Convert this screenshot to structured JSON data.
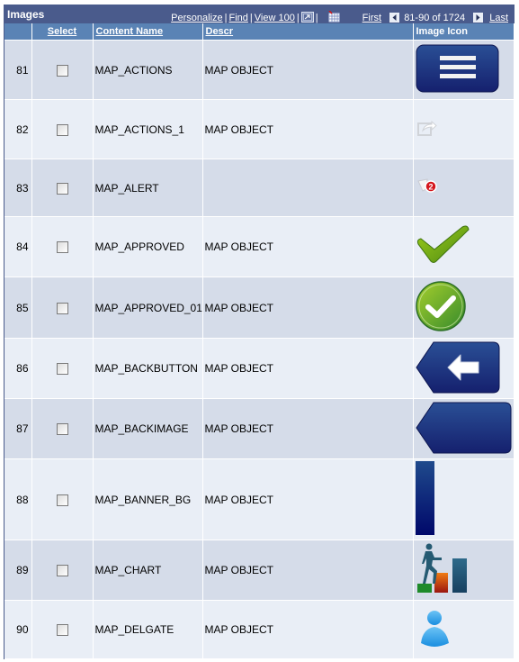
{
  "grid": {
    "title": "Images",
    "nav": {
      "personalize": "Personalize",
      "find": "Find",
      "view_all": "View 100",
      "separator": "|",
      "first": "First",
      "range": "81-90 of 1724",
      "last": "Last"
    },
    "columns": {
      "row_num": "",
      "select": "Select",
      "content_name": "Content Name",
      "descr": "Descr",
      "image_icon": "Image Icon"
    },
    "rows": [
      {
        "num": "81",
        "selected": false,
        "content_name": "MAP_ACTIONS",
        "descr": "MAP OBJECT",
        "icon": "menu-button-icon"
      },
      {
        "num": "82",
        "selected": false,
        "content_name": "MAP_ACTIONS_1",
        "descr": "MAP OBJECT",
        "icon": "share-icon"
      },
      {
        "num": "83",
        "selected": false,
        "content_name": "MAP_ALERT",
        "descr": "",
        "icon": "alert-flag-icon",
        "badge": "2"
      },
      {
        "num": "84",
        "selected": false,
        "content_name": "MAP_APPROVED",
        "descr": "MAP OBJECT",
        "icon": "checkmark-icon"
      },
      {
        "num": "85",
        "selected": false,
        "content_name": "MAP_APPROVED_01",
        "descr": "MAP OBJECT",
        "icon": "check-circle-icon"
      },
      {
        "num": "86",
        "selected": false,
        "content_name": "MAP_BACKBUTTON",
        "descr": "MAP OBJECT",
        "icon": "back-button-icon"
      },
      {
        "num": "87",
        "selected": false,
        "content_name": "MAP_BACKIMAGE",
        "descr": "MAP OBJECT",
        "icon": "back-image-icon"
      },
      {
        "num": "88",
        "selected": false,
        "content_name": "MAP_BANNER_BG",
        "descr": "MAP OBJECT",
        "icon": "banner-bg-icon"
      },
      {
        "num": "89",
        "selected": false,
        "content_name": "MAP_CHART",
        "descr": "MAP OBJECT",
        "icon": "chart-icon"
      },
      {
        "num": "90",
        "selected": false,
        "content_name": "MAP_DELGATE",
        "descr": "MAP OBJECT",
        "icon": "user-icon"
      }
    ],
    "colors": {
      "title_bar": "#4a5b8c",
      "header": "#5a83b5",
      "row_odd": "#d5dce9",
      "row_even": "#e9eef6",
      "icon_blue": "#1f3a8a",
      "icon_green": "#6aa61a"
    }
  }
}
